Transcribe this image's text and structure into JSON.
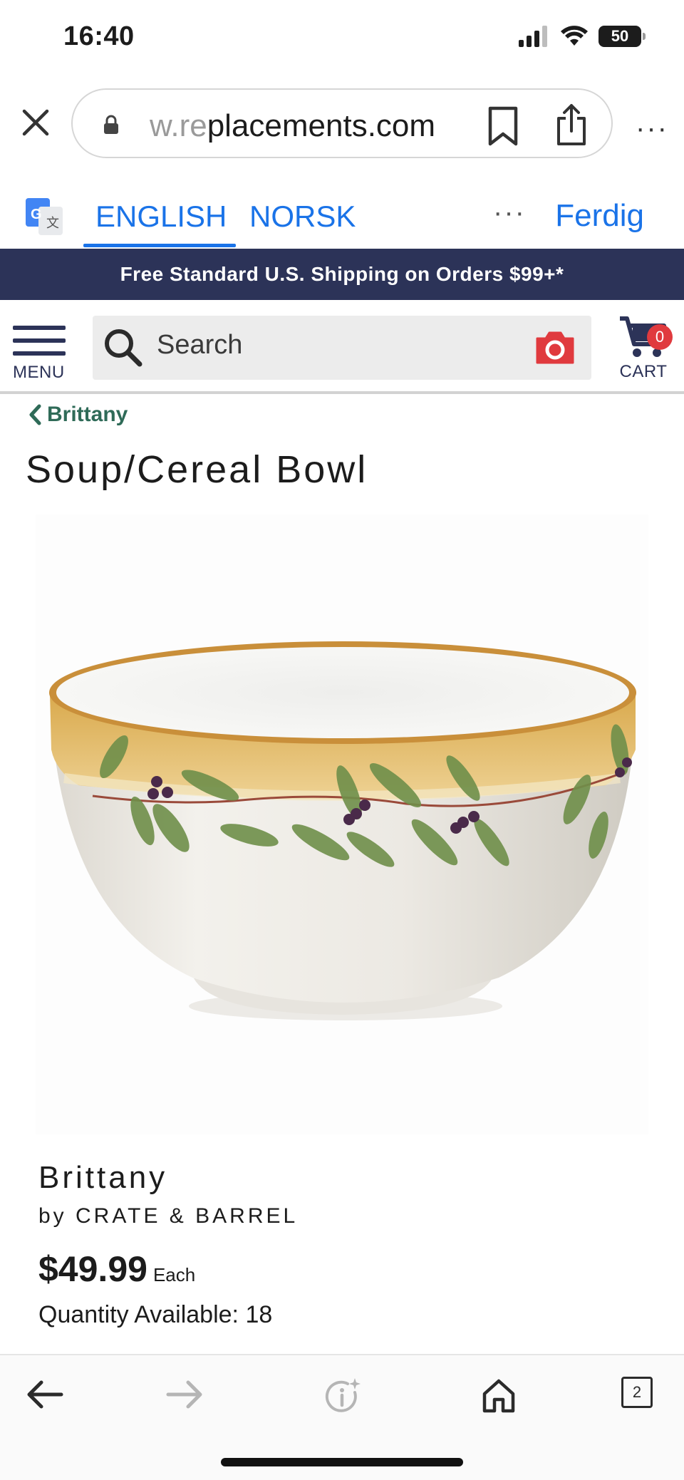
{
  "status_bar": {
    "time": "16:40",
    "battery": "50"
  },
  "browser": {
    "url_faded": "w.re",
    "url_main": "placements.com",
    "icons": {
      "close": "close-icon",
      "lock": "lock-icon",
      "bookmark": "bookmark-icon",
      "share": "share-icon",
      "more": "more-icon"
    },
    "more_label": "···"
  },
  "translate_bar": {
    "tabs": [
      "ENGLISH",
      "NORSK"
    ],
    "active_tab": "ENGLISH",
    "more_label": "···",
    "done_label": "Ferdig"
  },
  "promo": {
    "text": "Free Standard U.S. Shipping on Orders $99+*"
  },
  "header": {
    "menu_label": "MENU",
    "search_placeholder": "Search",
    "cart_label": "CART",
    "cart_count": "0"
  },
  "breadcrumb": {
    "label": "Brittany"
  },
  "product": {
    "title": "Soup/Cereal Bowl",
    "pattern": "Brittany",
    "manufacturer": "by CRATE & BARREL",
    "price": "$49.99",
    "price_unit": "Each",
    "quantity_available": "Quantity Available: 18"
  },
  "toolbar": {
    "tabs_count": "2"
  },
  "colors": {
    "navy": "#2c3358",
    "accent_blue": "#1a73e8",
    "breadcrumb_green": "#2f6b58",
    "badge_red": "#e03a3e",
    "camera_red": "#e03a3e"
  }
}
